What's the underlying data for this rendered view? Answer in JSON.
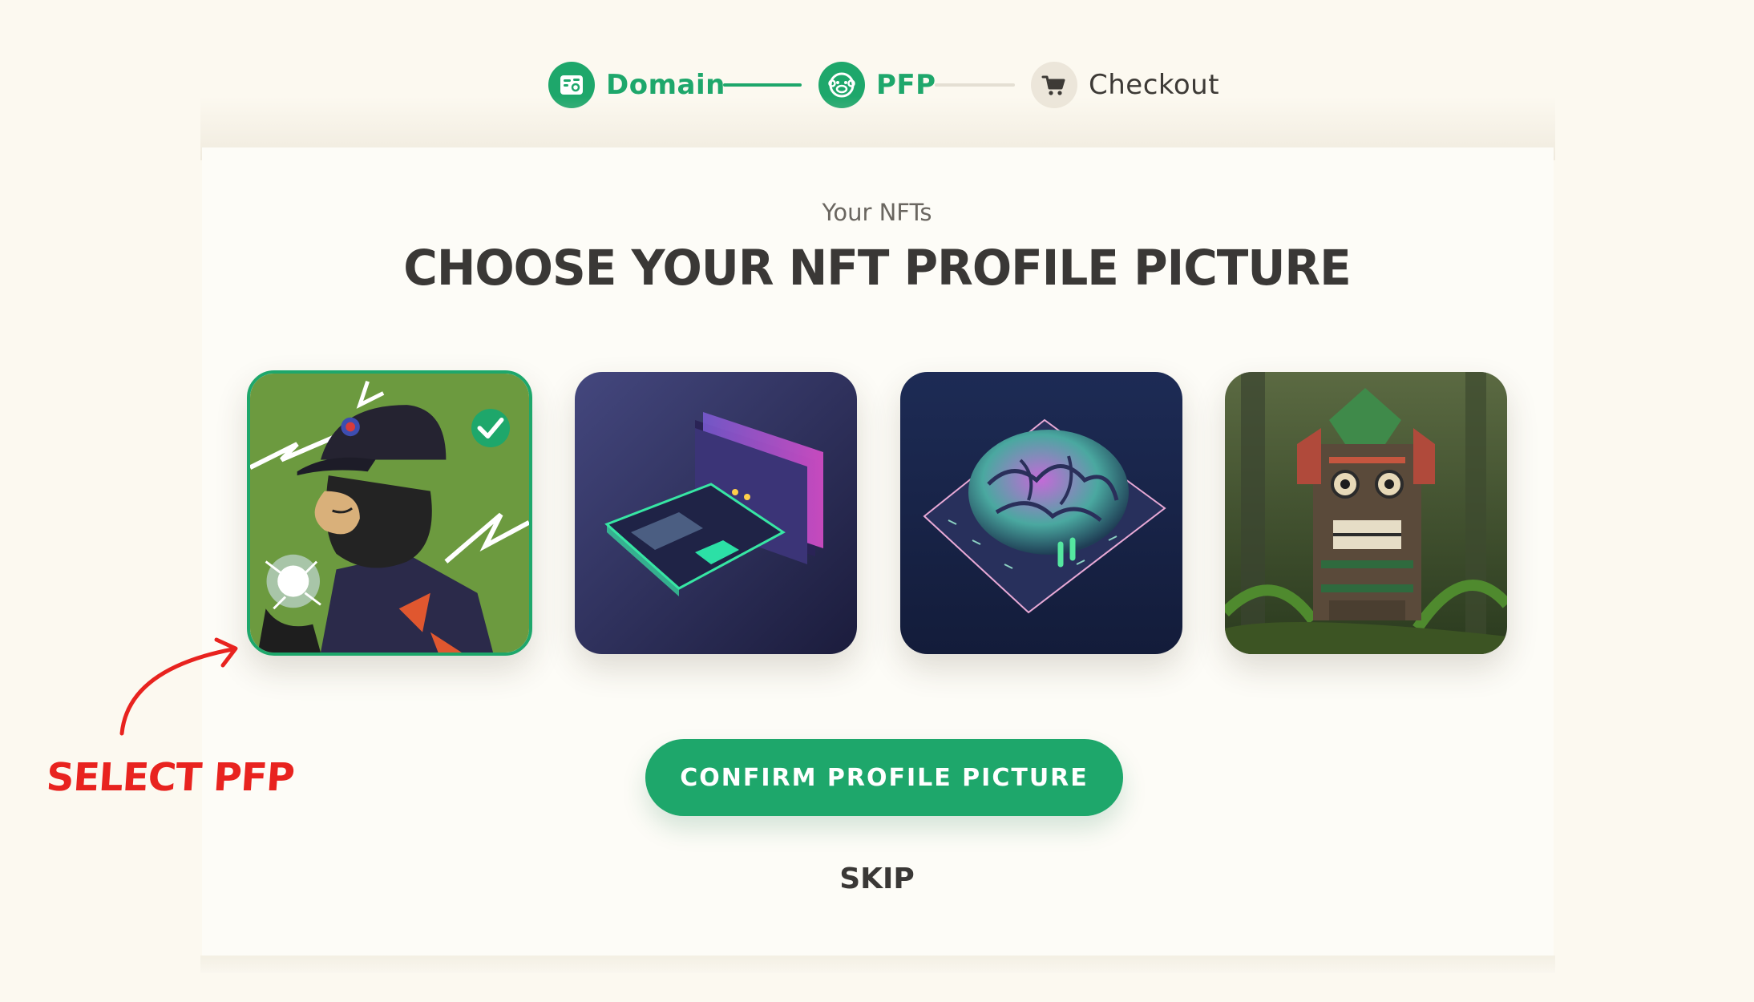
{
  "stepper": {
    "steps": [
      {
        "label": "Domain",
        "icon": "id-card-icon",
        "state": "complete"
      },
      {
        "label": "PFP",
        "icon": "monkey-face-icon",
        "state": "active"
      },
      {
        "label": "Checkout",
        "icon": "cart-icon",
        "state": "upcoming"
      }
    ]
  },
  "main": {
    "subtitle": "Your NFTs",
    "title": "CHOOSE YOUR NFT PROFILE PICTURE",
    "nfts": [
      {
        "name": "lightning-ape",
        "selected": true
      },
      {
        "name": "isometric-wallet",
        "selected": false
      },
      {
        "name": "neon-brain",
        "selected": false
      },
      {
        "name": "jungle-totem",
        "selected": false
      }
    ],
    "confirm_label": "CONFIRM PROFILE PICTURE",
    "skip_label": "SKIP"
  },
  "annotation": {
    "text": "SELECT PFP"
  },
  "colors": {
    "accent": "#1ea76b",
    "background": "#fcf9f0",
    "annotation": "#e8231f"
  }
}
